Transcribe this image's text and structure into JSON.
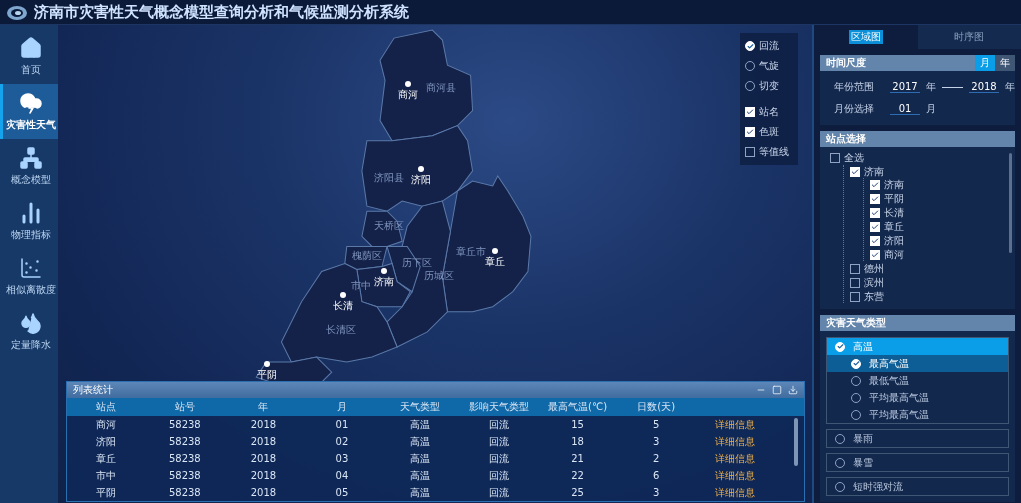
{
  "app": {
    "title": "济南市灾害性天气概念模型查询分析和气候监测分析系统"
  },
  "nav": [
    {
      "label": "首页",
      "selected": false
    },
    {
      "label": "灾害性天气",
      "selected": true
    },
    {
      "label": "概念模型",
      "selected": false
    },
    {
      "label": "物理指标",
      "selected": false
    },
    {
      "label": "相似离散度",
      "selected": false
    },
    {
      "label": "定量降水",
      "selected": false
    }
  ],
  "map": {
    "regions": [
      "商河县",
      "济阳县",
      "天桥区",
      "槐荫区",
      "历下区",
      "市中",
      "历城区",
      "章丘市",
      "长清区"
    ],
    "stations": [
      "商河",
      "济阳",
      "济南",
      "章丘",
      "长清",
      "平阴"
    ]
  },
  "map_options": {
    "layers": [
      {
        "label": "回流",
        "selected": true
      },
      {
        "label": "气旋",
        "selected": false
      },
      {
        "label": "切变",
        "selected": false
      }
    ],
    "overlays": [
      {
        "label": "站名",
        "checked": true
      },
      {
        "label": "色斑",
        "checked": true
      },
      {
        "label": "等值线",
        "checked": false
      }
    ]
  },
  "table": {
    "title": "列表统计",
    "columns": [
      "站点",
      "站号",
      "年",
      "月",
      "天气类型",
      "影响天气类型",
      "最高气温(℃)",
      "日数(天)"
    ],
    "rows": [
      [
        "商河",
        "58238",
        "2018",
        "01",
        "高温",
        "回流",
        "15",
        "5",
        "详细信息"
      ],
      [
        "济阳",
        "58238",
        "2018",
        "02",
        "高温",
        "回流",
        "18",
        "3",
        "详细信息"
      ],
      [
        "章丘",
        "58238",
        "2018",
        "03",
        "高温",
        "回流",
        "21",
        "2",
        "详细信息"
      ],
      [
        "市中",
        "58238",
        "2018",
        "04",
        "高温",
        "回流",
        "22",
        "6",
        "详细信息"
      ],
      [
        "平阴",
        "58238",
        "2018",
        "05",
        "高温",
        "回流",
        "25",
        "3",
        "详细信息"
      ]
    ]
  },
  "tabs": [
    {
      "label": "区域图",
      "selected": true
    },
    {
      "label": "时序图",
      "selected": false
    }
  ],
  "time_scale": {
    "title": "时间尺度",
    "units": [
      {
        "label": "月",
        "selected": true
      },
      {
        "label": "年",
        "selected": false
      }
    ],
    "year_label": "年份范围",
    "year_from": "2017",
    "year_from_unit": "年",
    "year_to": "2018",
    "year_to_unit": "年",
    "month_label": "月份选择",
    "month": "01",
    "month_unit": "月"
  },
  "stations": {
    "title": "站点选择",
    "tree": [
      {
        "label": "全选",
        "checked": false,
        "children": [
          {
            "label": "济南",
            "checked": true,
            "children": [
              {
                "label": "济南",
                "checked": true
              },
              {
                "label": "平阴",
                "checked": true
              },
              {
                "label": "长清",
                "checked": true
              },
              {
                "label": "章丘",
                "checked": true
              },
              {
                "label": "济阳",
                "checked": true
              },
              {
                "label": "商河",
                "checked": true
              }
            ]
          },
          {
            "label": "德州",
            "checked": false
          },
          {
            "label": "滨州",
            "checked": false
          },
          {
            "label": "东营",
            "checked": false
          }
        ]
      }
    ]
  },
  "weather_types": {
    "title": "灾害天气类型",
    "groups": [
      {
        "label": "高温",
        "selected": true,
        "children": [
          {
            "label": "最高气温",
            "selected": true
          },
          {
            "label": "最低气温",
            "selected": false
          },
          {
            "label": "平均最高气温",
            "selected": false
          },
          {
            "label": "平均最高气温",
            "selected": false
          }
        ]
      },
      {
        "label": "暴雨",
        "selected": false
      },
      {
        "label": "暴雪",
        "selected": false
      },
      {
        "label": "短时强对流",
        "selected": false
      }
    ]
  }
}
